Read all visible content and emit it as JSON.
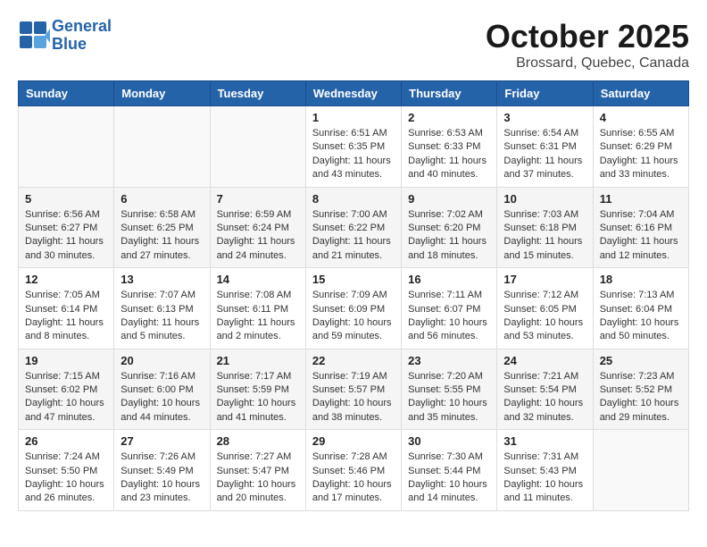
{
  "header": {
    "logo_line1": "General",
    "logo_line2": "Blue",
    "month": "October 2025",
    "location": "Brossard, Quebec, Canada"
  },
  "days_of_week": [
    "Sunday",
    "Monday",
    "Tuesday",
    "Wednesday",
    "Thursday",
    "Friday",
    "Saturday"
  ],
  "weeks": [
    [
      {
        "day": "",
        "info": ""
      },
      {
        "day": "",
        "info": ""
      },
      {
        "day": "",
        "info": ""
      },
      {
        "day": "1",
        "info": "Sunrise: 6:51 AM\nSunset: 6:35 PM\nDaylight: 11 hours and 43 minutes."
      },
      {
        "day": "2",
        "info": "Sunrise: 6:53 AM\nSunset: 6:33 PM\nDaylight: 11 hours and 40 minutes."
      },
      {
        "day": "3",
        "info": "Sunrise: 6:54 AM\nSunset: 6:31 PM\nDaylight: 11 hours and 37 minutes."
      },
      {
        "day": "4",
        "info": "Sunrise: 6:55 AM\nSunset: 6:29 PM\nDaylight: 11 hours and 33 minutes."
      }
    ],
    [
      {
        "day": "5",
        "info": "Sunrise: 6:56 AM\nSunset: 6:27 PM\nDaylight: 11 hours and 30 minutes."
      },
      {
        "day": "6",
        "info": "Sunrise: 6:58 AM\nSunset: 6:25 PM\nDaylight: 11 hours and 27 minutes."
      },
      {
        "day": "7",
        "info": "Sunrise: 6:59 AM\nSunset: 6:24 PM\nDaylight: 11 hours and 24 minutes."
      },
      {
        "day": "8",
        "info": "Sunrise: 7:00 AM\nSunset: 6:22 PM\nDaylight: 11 hours and 21 minutes."
      },
      {
        "day": "9",
        "info": "Sunrise: 7:02 AM\nSunset: 6:20 PM\nDaylight: 11 hours and 18 minutes."
      },
      {
        "day": "10",
        "info": "Sunrise: 7:03 AM\nSunset: 6:18 PM\nDaylight: 11 hours and 15 minutes."
      },
      {
        "day": "11",
        "info": "Sunrise: 7:04 AM\nSunset: 6:16 PM\nDaylight: 11 hours and 12 minutes."
      }
    ],
    [
      {
        "day": "12",
        "info": "Sunrise: 7:05 AM\nSunset: 6:14 PM\nDaylight: 11 hours and 8 minutes."
      },
      {
        "day": "13",
        "info": "Sunrise: 7:07 AM\nSunset: 6:13 PM\nDaylight: 11 hours and 5 minutes."
      },
      {
        "day": "14",
        "info": "Sunrise: 7:08 AM\nSunset: 6:11 PM\nDaylight: 11 hours and 2 minutes."
      },
      {
        "day": "15",
        "info": "Sunrise: 7:09 AM\nSunset: 6:09 PM\nDaylight: 10 hours and 59 minutes."
      },
      {
        "day": "16",
        "info": "Sunrise: 7:11 AM\nSunset: 6:07 PM\nDaylight: 10 hours and 56 minutes."
      },
      {
        "day": "17",
        "info": "Sunrise: 7:12 AM\nSunset: 6:05 PM\nDaylight: 10 hours and 53 minutes."
      },
      {
        "day": "18",
        "info": "Sunrise: 7:13 AM\nSunset: 6:04 PM\nDaylight: 10 hours and 50 minutes."
      }
    ],
    [
      {
        "day": "19",
        "info": "Sunrise: 7:15 AM\nSunset: 6:02 PM\nDaylight: 10 hours and 47 minutes."
      },
      {
        "day": "20",
        "info": "Sunrise: 7:16 AM\nSunset: 6:00 PM\nDaylight: 10 hours and 44 minutes."
      },
      {
        "day": "21",
        "info": "Sunrise: 7:17 AM\nSunset: 5:59 PM\nDaylight: 10 hours and 41 minutes."
      },
      {
        "day": "22",
        "info": "Sunrise: 7:19 AM\nSunset: 5:57 PM\nDaylight: 10 hours and 38 minutes."
      },
      {
        "day": "23",
        "info": "Sunrise: 7:20 AM\nSunset: 5:55 PM\nDaylight: 10 hours and 35 minutes."
      },
      {
        "day": "24",
        "info": "Sunrise: 7:21 AM\nSunset: 5:54 PM\nDaylight: 10 hours and 32 minutes."
      },
      {
        "day": "25",
        "info": "Sunrise: 7:23 AM\nSunset: 5:52 PM\nDaylight: 10 hours and 29 minutes."
      }
    ],
    [
      {
        "day": "26",
        "info": "Sunrise: 7:24 AM\nSunset: 5:50 PM\nDaylight: 10 hours and 26 minutes."
      },
      {
        "day": "27",
        "info": "Sunrise: 7:26 AM\nSunset: 5:49 PM\nDaylight: 10 hours and 23 minutes."
      },
      {
        "day": "28",
        "info": "Sunrise: 7:27 AM\nSunset: 5:47 PM\nDaylight: 10 hours and 20 minutes."
      },
      {
        "day": "29",
        "info": "Sunrise: 7:28 AM\nSunset: 5:46 PM\nDaylight: 10 hours and 17 minutes."
      },
      {
        "day": "30",
        "info": "Sunrise: 7:30 AM\nSunset: 5:44 PM\nDaylight: 10 hours and 14 minutes."
      },
      {
        "day": "31",
        "info": "Sunrise: 7:31 AM\nSunset: 5:43 PM\nDaylight: 10 hours and 11 minutes."
      },
      {
        "day": "",
        "info": ""
      }
    ]
  ]
}
